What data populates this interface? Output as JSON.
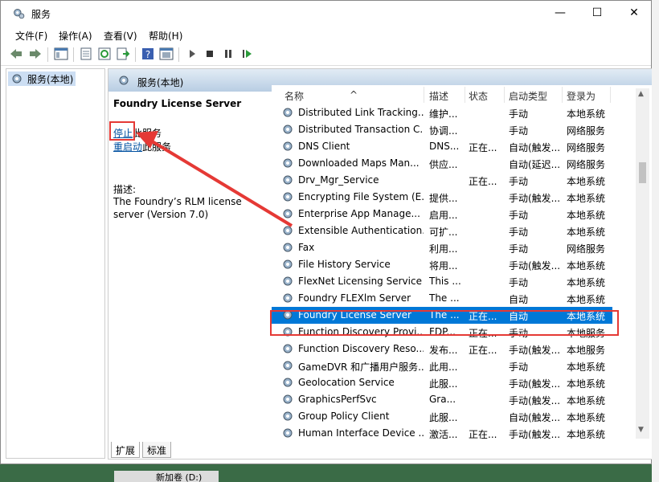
{
  "window": {
    "title": "服务",
    "minimize": "—",
    "maximize": "☐",
    "close": "✕"
  },
  "menu": [
    "文件(F)",
    "操作(A)",
    "查看(V)",
    "帮助(H)"
  ],
  "toolbar_icons": [
    "back-icon",
    "forward-icon",
    "show-tree-icon",
    "properties-icon",
    "refresh-icon",
    "export-icon",
    "help-icon",
    "console-icon",
    "start-icon",
    "stop-icon",
    "pause-icon",
    "restart-icon"
  ],
  "tree": {
    "item": "服务(本地)"
  },
  "pane": {
    "header": "服务(本地)",
    "service_name": "Foundry License Server",
    "stop_link": "停止",
    "stop_suffix": "此服务",
    "restart_link": "重启动",
    "restart_suffix": "此服务",
    "desc_label": "描述:",
    "desc_text": "The Foundry’s RLM license server (Version 7.0)"
  },
  "columns": {
    "name": "名称",
    "desc": "描述",
    "state": "状态",
    "start": "启动类型",
    "logon": "登录为"
  },
  "rows": [
    {
      "name": "Distributed Link Tracking...",
      "desc": "维护...",
      "state": "",
      "start": "手动",
      "logon": "本地系统"
    },
    {
      "name": "Distributed Transaction C...",
      "desc": "协调...",
      "state": "",
      "start": "手动",
      "logon": "网络服务"
    },
    {
      "name": "DNS Client",
      "desc": "DNS...",
      "state": "正在...",
      "start": "自动(触发...",
      "logon": "网络服务"
    },
    {
      "name": "Downloaded Maps Man...",
      "desc": "供应...",
      "state": "",
      "start": "自动(延迟...",
      "logon": "网络服务"
    },
    {
      "name": "Drv_Mgr_Service",
      "desc": "",
      "state": "正在...",
      "start": "手动",
      "logon": "本地系统"
    },
    {
      "name": "Encrypting File System (E...",
      "desc": "提供...",
      "state": "",
      "start": "手动(触发...",
      "logon": "本地系统"
    },
    {
      "name": "Enterprise App Manage...",
      "desc": "启用...",
      "state": "",
      "start": "手动",
      "logon": "本地系统"
    },
    {
      "name": "Extensible Authentication...",
      "desc": "可扩...",
      "state": "",
      "start": "手动",
      "logon": "本地系统"
    },
    {
      "name": "Fax",
      "desc": "利用...",
      "state": "",
      "start": "手动",
      "logon": "网络服务"
    },
    {
      "name": "File History Service",
      "desc": "将用...",
      "state": "",
      "start": "手动(触发...",
      "logon": "本地系统"
    },
    {
      "name": "FlexNet Licensing Service",
      "desc": "This ...",
      "state": "",
      "start": "手动",
      "logon": "本地系统"
    },
    {
      "name": "Foundry FLEXlm Server",
      "desc": "The ...",
      "state": "",
      "start": "自动",
      "logon": "本地系统"
    },
    {
      "name": "Foundry License Server",
      "desc": "The ...",
      "state": "正在...",
      "start": "自动",
      "logon": "本地系统"
    },
    {
      "name": "Function Discovery Provi...",
      "desc": "FDP...",
      "state": "正在...",
      "start": "手动",
      "logon": "本地服务"
    },
    {
      "name": "Function Discovery Reso...",
      "desc": "发布...",
      "state": "正在...",
      "start": "手动(触发...",
      "logon": "本地服务"
    },
    {
      "name": "GameDVR 和广播用户服务...",
      "desc": "此用...",
      "state": "",
      "start": "手动",
      "logon": "本地系统"
    },
    {
      "name": "Geolocation Service",
      "desc": "此服...",
      "state": "",
      "start": "手动(触发...",
      "logon": "本地系统"
    },
    {
      "name": "GraphicsPerfSvc",
      "desc": "Gra...",
      "state": "",
      "start": "手动(触发...",
      "logon": "本地系统"
    },
    {
      "name": "Group Policy Client",
      "desc": "此服...",
      "state": "",
      "start": "自动(触发...",
      "logon": "本地系统"
    },
    {
      "name": "Human Interface Device ...",
      "desc": "激活...",
      "state": "正在...",
      "start": "手动(触发...",
      "logon": "本地系统"
    }
  ],
  "selected_index": 12,
  "tabs": [
    "扩展",
    "标准"
  ],
  "taskbar_peek": "新加卷 (D:)"
}
